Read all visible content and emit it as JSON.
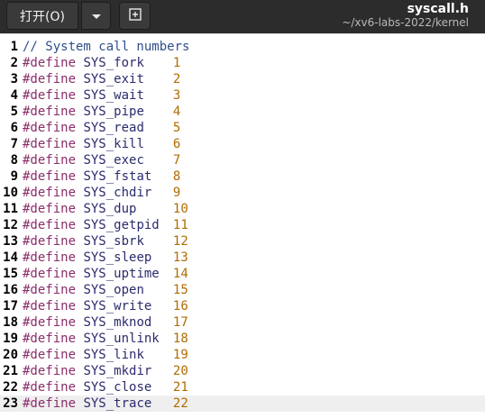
{
  "toolbar": {
    "open_label": "打开(O)",
    "open_menu_icon": "chevron-down-icon",
    "new_tab_icon": "new-document-icon"
  },
  "window": {
    "title": "syscall.h",
    "subtitle": "~/xv6-labs-2022/kernel"
  },
  "editor": {
    "current_line": 23,
    "lines": [
      {
        "n": "1",
        "comment": "// System call numbers"
      },
      {
        "n": "2",
        "kw": "#define",
        "name": "SYS_fork",
        "num": "1"
      },
      {
        "n": "3",
        "kw": "#define",
        "name": "SYS_exit",
        "num": "2"
      },
      {
        "n": "4",
        "kw": "#define",
        "name": "SYS_wait",
        "num": "3"
      },
      {
        "n": "5",
        "kw": "#define",
        "name": "SYS_pipe",
        "num": "4"
      },
      {
        "n": "6",
        "kw": "#define",
        "name": "SYS_read",
        "num": "5"
      },
      {
        "n": "7",
        "kw": "#define",
        "name": "SYS_kill",
        "num": "6"
      },
      {
        "n": "8",
        "kw": "#define",
        "name": "SYS_exec",
        "num": "7"
      },
      {
        "n": "9",
        "kw": "#define",
        "name": "SYS_fstat",
        "num": "8"
      },
      {
        "n": "10",
        "kw": "#define",
        "name": "SYS_chdir",
        "num": "9"
      },
      {
        "n": "11",
        "kw": "#define",
        "name": "SYS_dup",
        "num": "10"
      },
      {
        "n": "12",
        "kw": "#define",
        "name": "SYS_getpid",
        "num": "11"
      },
      {
        "n": "13",
        "kw": "#define",
        "name": "SYS_sbrk",
        "num": "12"
      },
      {
        "n": "14",
        "kw": "#define",
        "name": "SYS_sleep",
        "num": "13"
      },
      {
        "n": "15",
        "kw": "#define",
        "name": "SYS_uptime",
        "num": "14"
      },
      {
        "n": "16",
        "kw": "#define",
        "name": "SYS_open",
        "num": "15"
      },
      {
        "n": "17",
        "kw": "#define",
        "name": "SYS_write",
        "num": "16"
      },
      {
        "n": "18",
        "kw": "#define",
        "name": "SYS_mknod",
        "num": "17"
      },
      {
        "n": "19",
        "kw": "#define",
        "name": "SYS_unlink",
        "num": "18"
      },
      {
        "n": "20",
        "kw": "#define",
        "name": "SYS_link",
        "num": "19"
      },
      {
        "n": "21",
        "kw": "#define",
        "name": "SYS_mkdir",
        "num": "20"
      },
      {
        "n": "22",
        "kw": "#define",
        "name": "SYS_close",
        "num": "21"
      },
      {
        "n": "23",
        "kw": "#define",
        "name": "SYS_trace",
        "num": "22"
      }
    ]
  }
}
